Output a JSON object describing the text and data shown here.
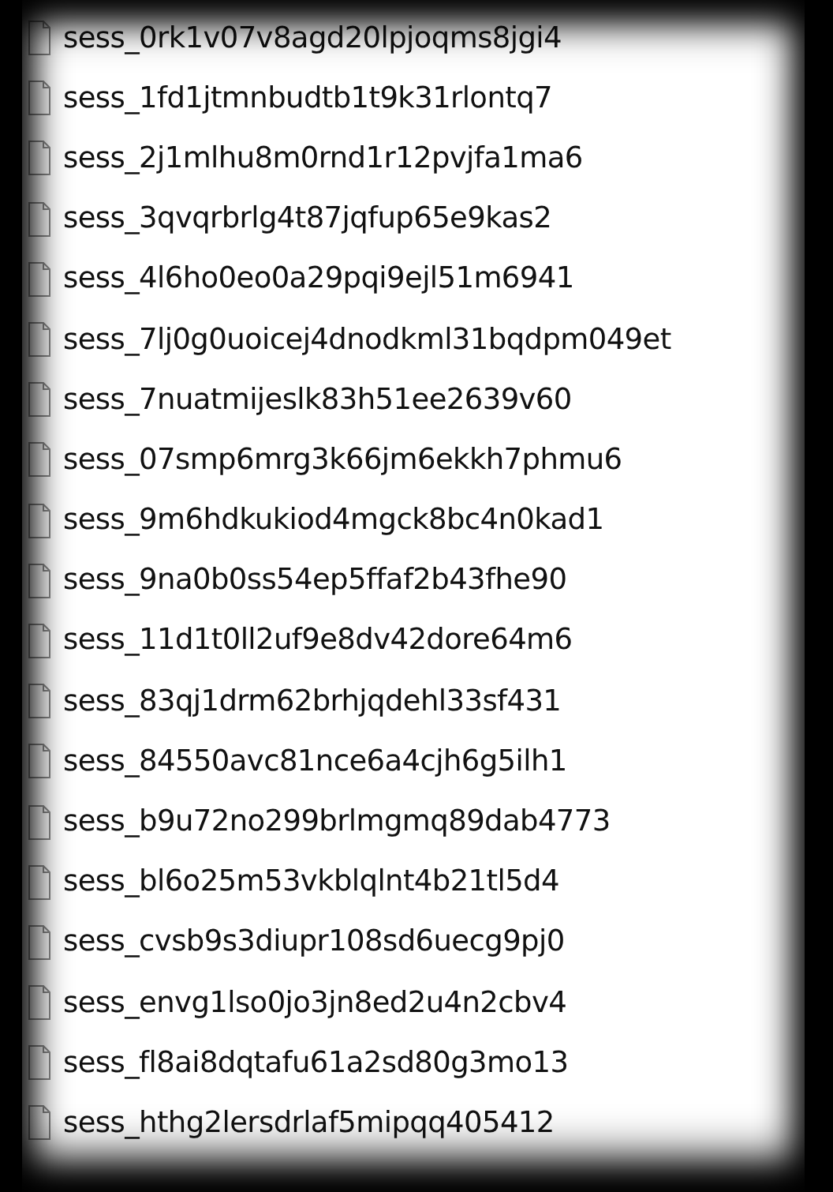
{
  "files": [
    {
      "name": "sess_0rk1v07v8agd20lpjoqms8jgi4"
    },
    {
      "name": "sess_1fd1jtmnbudtb1t9k31rlontq7"
    },
    {
      "name": "sess_2j1mlhu8m0rnd1r12pvjfa1ma6"
    },
    {
      "name": "sess_3qvqrbrlg4t87jqfup65e9kas2"
    },
    {
      "name": "sess_4l6ho0eo0a29pqi9ejl51m6941"
    },
    {
      "name": "sess_7lj0g0uoicej4dnodkml31bqdpm049et"
    },
    {
      "name": "sess_7nuatmijeslk83h51ee2639v60"
    },
    {
      "name": "sess_07smp6mrg3k66jm6ekkh7phmu6"
    },
    {
      "name": "sess_9m6hdkukiod4mgck8bc4n0kad1"
    },
    {
      "name": "sess_9na0b0ss54ep5ffaf2b43fhe90"
    },
    {
      "name": "sess_11d1t0ll2uf9e8dv42dore64m6"
    },
    {
      "name": "sess_83qj1drm62brhjqdehl33sf431"
    },
    {
      "name": "sess_84550avc81nce6a4cjh6g5ilh1"
    },
    {
      "name": "sess_b9u72no299brlmgmq89dab4773"
    },
    {
      "name": "sess_bl6o25m53vkblqlnt4b21tl5d4"
    },
    {
      "name": "sess_cvsb9s3diupr108sd6uecg9pj0"
    },
    {
      "name": "sess_envg1lso0jo3jn8ed2u4n2cbv4"
    },
    {
      "name": "sess_fl8ai8dqtafu61a2sd80g3mo13"
    },
    {
      "name": "sess_hthg2lersdrlaf5mipqq405412"
    }
  ]
}
